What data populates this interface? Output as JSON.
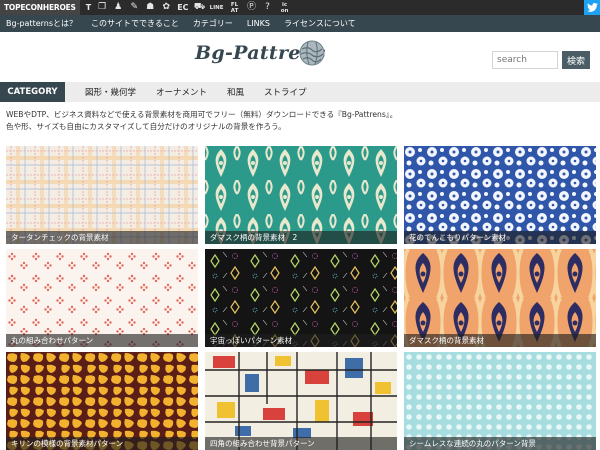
{
  "topbar": {
    "logo": "TOPECONHEROES",
    "icons": [
      "t-icon",
      "copy-icon",
      "person-icon",
      "chat-icon",
      "bag-icon",
      "flower-icon",
      "ec",
      "cart-icon",
      "line-icon",
      "fl-at-icon",
      "p-icon",
      "help-icon",
      "icon-icon"
    ],
    "ec_text": "EC",
    "line_text": "LINE",
    "flat_text": "FL AT",
    "icon_text": "ic on"
  },
  "nav": {
    "items": [
      "Bg-patternsとは？",
      "このサイトでできること",
      "カテゴリー",
      "LINKS",
      "ライセンスについて"
    ]
  },
  "header": {
    "title": "Bg-Pattrens",
    "search_placeholder": "search",
    "search_button": "検索"
  },
  "category": {
    "label": "CATEGORY",
    "items": [
      "図形・幾何学",
      "オーナメント",
      "和風",
      "ストライプ"
    ]
  },
  "intro": {
    "line1": "WEBやDTP、ビジネス資料などで使える背景素材を商用可でフリー（無料）ダウンロードできる『Bg-Pattrens』。",
    "line2": "色や形、サイズも自由にカスタマイズして自分だけのオリジナルの背景を作ろう。"
  },
  "cards": [
    {
      "caption": "タータンチェックの背景素材"
    },
    {
      "caption": "ダマスク柄の背景素材　2"
    },
    {
      "caption": "花のてんこもりパターン素材"
    },
    {
      "caption": "丸の組み合わせパターン"
    },
    {
      "caption": "宇宙っぽいパターン素材"
    },
    {
      "caption": "ダマスク柄の背景素材"
    },
    {
      "caption": "キリンの模様の背景素材パターン"
    },
    {
      "caption": "四角の組み合わせ背景パターン"
    },
    {
      "caption": "シームレスな連続の丸のパターン背景"
    }
  ],
  "colors": {
    "nav_dark": "#36474f",
    "topbar": "#2b2b2b",
    "twitter": "#1da1f2"
  }
}
